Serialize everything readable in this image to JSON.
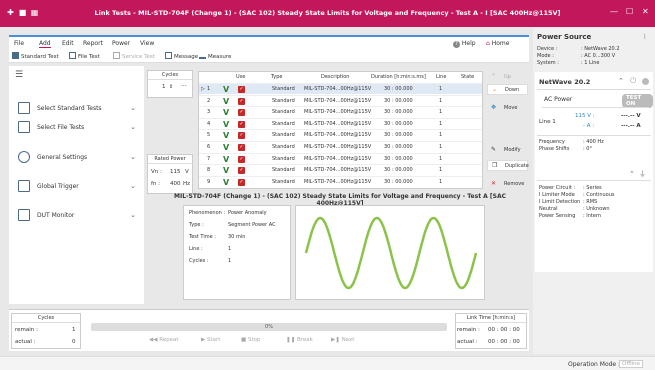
{
  "window": {
    "title": "Link Tests - MIL-STD-704F (Change 1) - (SAC 102) Steady State Limits for Voltage and Frequency - Test A - I [SAC 400Hz@115V]",
    "minimize": "—",
    "maximize": "☐",
    "close": "✕"
  },
  "menu": {
    "items": [
      "File",
      "Add",
      "Edit",
      "Report",
      "Power",
      "View"
    ],
    "help": "Help",
    "home": "Home"
  },
  "toolbar": {
    "standard_test": "Standard Test",
    "file_test": "File Test",
    "service_test": "Service Test",
    "message": "Message",
    "measure": "Measure"
  },
  "sidebar": {
    "items": [
      {
        "label": "Select Standard Tests"
      },
      {
        "label": "Select File Tests"
      },
      {
        "label": "General Settings"
      },
      {
        "label": "Global Trigger"
      },
      {
        "label": "DUT Monitor"
      }
    ]
  },
  "cycles": {
    "header": "Cycles",
    "value": "1"
  },
  "rated_power": {
    "header": "Rated Power",
    "vn_label": "Vn :",
    "vn_value": "115",
    "vn_unit": "V",
    "fn_label": "fn :",
    "fn_value": "400",
    "fn_unit": "Hz"
  },
  "table": {
    "headers": [
      "Use",
      "Type",
      "Description",
      "Duration [h:min:s.ms]",
      "Line",
      "State"
    ],
    "rows": [
      {
        "num": "1",
        "type": "Standard",
        "desc": "MIL-STD-704...00Hz@115V",
        "dur": "30 : 00.000",
        "line": "1"
      },
      {
        "num": "2",
        "type": "Standard",
        "desc": "MIL-STD-704...00Hz@115V",
        "dur": "30 : 00.000",
        "line": "1"
      },
      {
        "num": "3",
        "type": "Standard",
        "desc": "MIL-STD-704...00Hz@115V",
        "dur": "30 : 00.000",
        "line": "1"
      },
      {
        "num": "4",
        "type": "Standard",
        "desc": "MIL-STD-704...00Hz@115V",
        "dur": "30 : 00.000",
        "line": "1"
      },
      {
        "num": "5",
        "type": "Standard",
        "desc": "MIL-STD-704...00Hz@115V",
        "dur": "30 : 00.000",
        "line": "1"
      },
      {
        "num": "6",
        "type": "Standard",
        "desc": "MIL-STD-704...00Hz@115V",
        "dur": "30 : 00.000",
        "line": "1"
      },
      {
        "num": "7",
        "type": "Standard",
        "desc": "MIL-STD-704...00Hz@115V",
        "dur": "30 : 00.000",
        "line": "1"
      },
      {
        "num": "8",
        "type": "Standard",
        "desc": "MIL-STD-704...00Hz@115V",
        "dur": "30 : 00.000",
        "line": "1"
      },
      {
        "num": "9",
        "type": "Standard",
        "desc": "MIL-STD-704...00Hz@115V",
        "dur": "30 : 00.000",
        "line": "1"
      }
    ]
  },
  "actions": {
    "up": "Up",
    "down": "Down",
    "move": "Move",
    "modify": "Modify",
    "duplicate": "Duplicate",
    "remove": "Remove"
  },
  "test_title": "MIL-STD-704F (Change 1) - (SAC 102) Steady State Limits for Voltage and Frequency - Test A [SAC 400Hz@115V]",
  "info": {
    "phenomenon_k": "Phenomenon :",
    "phenomenon_v": "Power Anomaly",
    "type_k": "Type :",
    "type_v": "Segment Power AC",
    "testtime_k": "Test Time :",
    "testtime_v": "30 min",
    "line_k": "Line :",
    "line_v": "1",
    "cycles_k": "Cycles :",
    "cycles_v": "1"
  },
  "bottom": {
    "cycles_header": "Cycles",
    "remain_label": "remain :",
    "remain_value": "1",
    "actual_label": "actual :",
    "actual_value": "0",
    "progress": "0%",
    "repeat": "Repeat",
    "start": "Start",
    "stop": "Stop",
    "break": "Break",
    "next": "Next",
    "linktime_header": "Link Time [h:min:s]",
    "lt_remain_label": "remain :",
    "lt_remain_value": "00 : 00 : 00",
    "lt_actual_label": "actual :",
    "lt_actual_value": "00 : 00 : 00"
  },
  "status": {
    "op_mode_label": "Operation Mode :",
    "op_mode_value": "Offline"
  },
  "power_source": {
    "title": "Power Source",
    "device_k": "Device :",
    "device_v": ": NetWave 20.2",
    "mode_k": "Mode :",
    "mode_v": ": AC 0...300 V",
    "system_k": "System :",
    "system_v": ": 1 Line",
    "nw_title": "NetWave 20.2",
    "ac_power": "AC Power",
    "test_on": "TEST ON",
    "line1": "Line 1",
    "set_v": "115 V :",
    "set_a": "- A :",
    "meas_v": "---.-- V",
    "meas_a": "---.-- A",
    "freq_k": "Frequency",
    "freq_v": ": 400 Hz",
    "phase_k": "Phase Shifts",
    "phase_v": ": 0°",
    "circuit_k": "Power Circuit :",
    "circuit_v": ": Series",
    "ilimit_k": "I Limiter Mode",
    "ilimit_v": ": Continuous",
    "idet_k": "I Limit Detection",
    "idet_v": ": RMS",
    "neutral_k": "Neutral",
    "neutral_v": ": Unknown",
    "psense_k": "Power Sensing",
    "psense_v": ": Intern"
  }
}
